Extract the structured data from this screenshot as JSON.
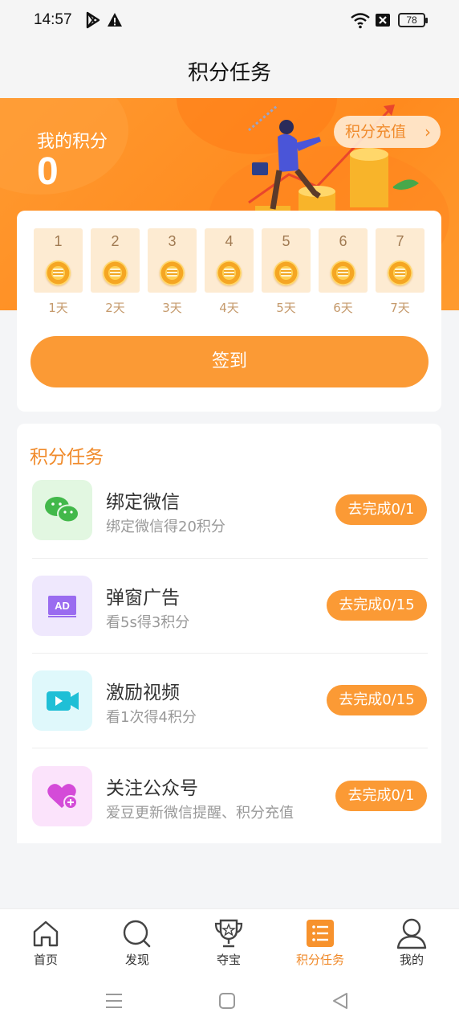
{
  "status_bar": {
    "time": "14:57",
    "battery": "78"
  },
  "header": {
    "title": "积分任务"
  },
  "banner": {
    "points_label": "我的积分",
    "points_value": "0",
    "recharge_label": "积分充值"
  },
  "checkin": {
    "days": [
      {
        "num": "1",
        "label": "1天"
      },
      {
        "num": "2",
        "label": "2天"
      },
      {
        "num": "3",
        "label": "3天"
      },
      {
        "num": "4",
        "label": "4天"
      },
      {
        "num": "5",
        "label": "5天"
      },
      {
        "num": "6",
        "label": "6天"
      },
      {
        "num": "7",
        "label": "7天"
      }
    ],
    "button_label": "签到"
  },
  "tasks": {
    "title": "积分任务",
    "items": [
      {
        "name": "绑定微信",
        "desc": "绑定微信得20积分",
        "button": "去完成0/1",
        "icon": "wechat-icon",
        "color": "#42b84a"
      },
      {
        "name": "弹窗广告",
        "desc": "看5s得3积分",
        "button": "去完成0/15",
        "icon": "ad-icon",
        "color": "#9a6cf0"
      },
      {
        "name": "激励视频",
        "desc": "看1次得4积分",
        "button": "去完成0/15",
        "icon": "video-icon",
        "color": "#1fbfd6"
      },
      {
        "name": "关注公众号",
        "desc": "爱豆更新微信提醒、积分充值",
        "button": "去完成0/1",
        "icon": "heart-plus-icon",
        "color": "#d44bd8"
      }
    ]
  },
  "bottom_nav": {
    "items": [
      {
        "label": "首页",
        "icon": "home-icon"
      },
      {
        "label": "发现",
        "icon": "discover-icon"
      },
      {
        "label": "夺宝",
        "icon": "trophy-icon"
      },
      {
        "label": "积分任务",
        "icon": "task-list-icon",
        "active": true
      },
      {
        "label": "我的",
        "icon": "user-icon"
      }
    ]
  },
  "colors": {
    "accent": "#fb9a35",
    "accent_text": "#f08a2a",
    "day_bg": "#fdebd2"
  }
}
